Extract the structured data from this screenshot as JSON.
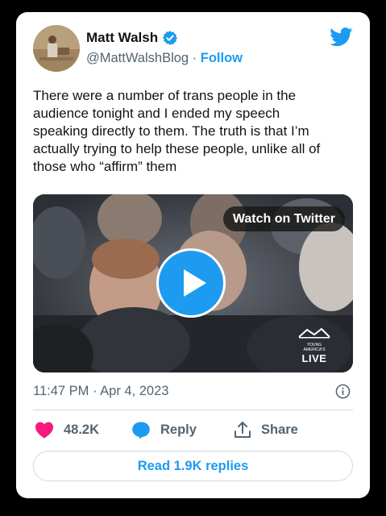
{
  "tweet": {
    "author_name": "Matt Walsh",
    "handle": "@MattWalshBlog",
    "separator": " · ",
    "follow_label": "Follow",
    "lines": [
      "There were a number of trans people in the",
      "audience tonight and I ended my speech",
      "speaking directly to them. The truth is that I’m",
      "actually trying to help these people, unlike all of",
      "those who “affirm” them"
    ],
    "timestamp": "11:47 PM · Apr 4, 2023"
  },
  "media": {
    "watch_label": "Watch on Twitter",
    "watermark_top": "YOUNG AMERICA'S",
    "live_label": "LIVE"
  },
  "actions": {
    "likes": "48.2K",
    "reply_label": "Reply",
    "share_label": "Share",
    "read_replies_label": "Read 1.9K replies"
  },
  "colors": {
    "accent": "#1d9bf0",
    "like": "#f91880",
    "text": "#0f1419",
    "muted": "#536471"
  },
  "icons": [
    "verified-badge-icon",
    "twitter-bird-icon",
    "play-icon",
    "info-icon",
    "heart-icon",
    "reply-bubble-icon",
    "share-icon"
  ]
}
